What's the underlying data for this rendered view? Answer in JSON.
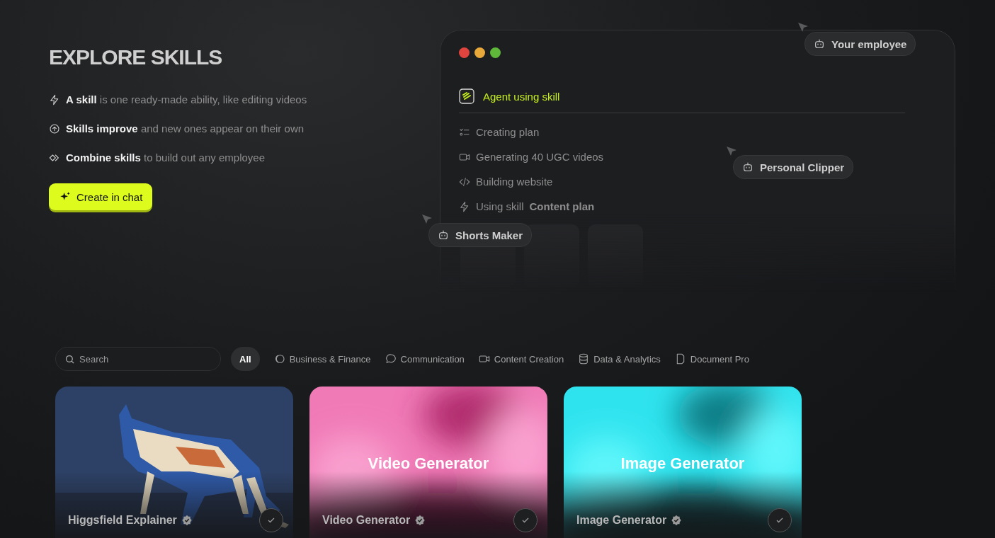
{
  "hero": {
    "title": "EXPLORE SKILLS",
    "points": [
      {
        "kind": "skill",
        "text": "**A skill** is one ready-made ability, like editing videos"
      },
      {
        "kind": "improve",
        "text": "**Skills improve** and new ones appear on their own"
      },
      {
        "kind": "combine",
        "text": "**Combine skills** to build out any employee"
      }
    ],
    "cta": "Create in chat"
  },
  "demo_window": {
    "heading": "Agent using skill",
    "steps": [
      {
        "kind": "plan",
        "label": "Creating plan"
      },
      {
        "kind": "video",
        "label": "Generating 40 UGC videos"
      },
      {
        "kind": "code",
        "label": "Building website"
      },
      {
        "kind": "skill",
        "label": "Using skill",
        "detail": "Content plan"
      }
    ],
    "agents": [
      {
        "label": "Your employee"
      },
      {
        "label": "Personal Clipper"
      },
      {
        "label": "Shorts Maker"
      }
    ]
  },
  "search": {
    "placeholder": "Search"
  },
  "categories": [
    {
      "kind": "all",
      "label": "All",
      "selected": true
    },
    {
      "kind": "business",
      "label": "Business & Finance",
      "selected": false
    },
    {
      "kind": "communication",
      "label": "Communication",
      "selected": false
    },
    {
      "kind": "content",
      "label": "Content Creation",
      "selected": false
    },
    {
      "kind": "data",
      "label": "Data & Analytics",
      "selected": false
    },
    {
      "kind": "document",
      "label": "Document Pro",
      "selected": false
    }
  ],
  "skills": [
    {
      "name": "Higgsfield Explainer",
      "verified": true
    },
    {
      "name": "Video Generator",
      "cover_title": "Video Generator",
      "verified": true
    },
    {
      "name": "Image Generator",
      "cover_title": "Image Generator",
      "verified": true
    }
  ]
}
